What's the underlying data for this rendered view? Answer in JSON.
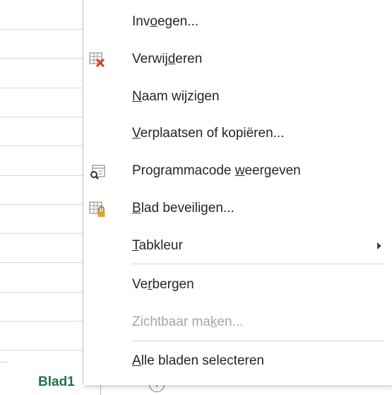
{
  "sheet": {
    "active_tab": "Blad1",
    "new_sheet_symbol": "+"
  },
  "context_menu": {
    "items": [
      {
        "label": "Invoegen...",
        "underline": "o",
        "icon": null,
        "enabled": true
      },
      {
        "label": "Verwijderen",
        "underline": "d",
        "icon": "delete-sheet-icon",
        "enabled": true
      },
      {
        "label": "Naam wijzigen",
        "underline": "N",
        "icon": null,
        "enabled": true
      },
      {
        "label": "Verplaatsen of kopiëren...",
        "underline": "V",
        "icon": null,
        "enabled": true
      },
      {
        "label": "Programmacode weergeven",
        "underline": "w",
        "icon": "view-code-icon",
        "enabled": true
      },
      {
        "label": "Blad beveiligen...",
        "underline": "B",
        "icon": "protect-sheet-icon",
        "enabled": true
      },
      {
        "label": "Tabkleur",
        "underline": "T",
        "icon": null,
        "enabled": true,
        "submenu": true
      },
      {
        "label": "Verbergen",
        "underline": "r",
        "icon": null,
        "enabled": true
      },
      {
        "label": "Zichtbaar maken...",
        "underline": "k",
        "icon": null,
        "enabled": false
      },
      {
        "label": "Alle bladen selecteren",
        "underline": "A",
        "icon": null,
        "enabled": true
      }
    ]
  },
  "colors": {
    "active_tab_text": "#217346",
    "delete_x": "#e0392b",
    "lock": "#e0a526",
    "disabled_text": "#a6a6a6"
  }
}
